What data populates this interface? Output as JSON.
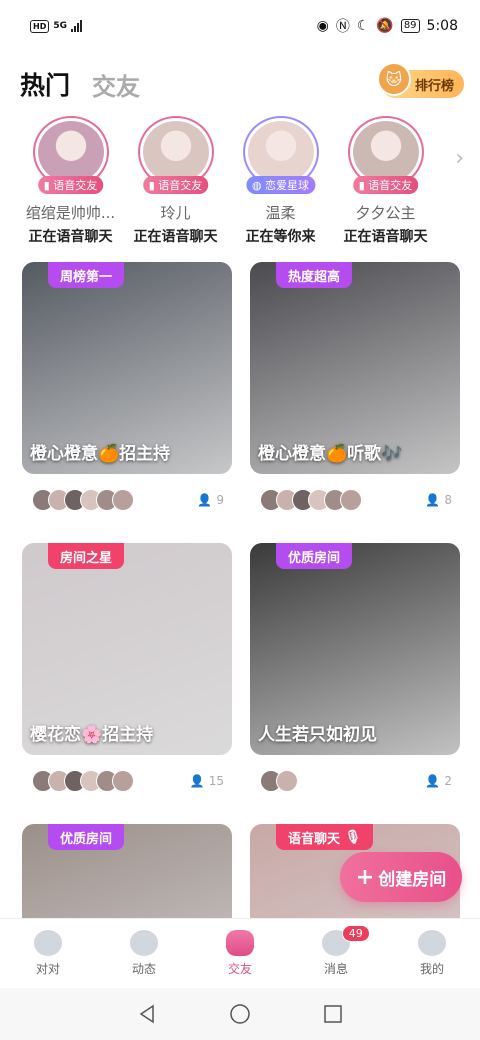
{
  "status_bar": {
    "net_label": "HD",
    "net_type": "5G",
    "battery": "89",
    "time": "5:08"
  },
  "header": {
    "tab_hot": "热门",
    "tab_friends": "交友",
    "rank_label": "排行榜"
  },
  "users": [
    {
      "name": "绾绾是帅帅...",
      "badge": "语音交友",
      "status": "正在语音聊天",
      "color": "#c9a0b5"
    },
    {
      "name": "玲儿",
      "badge": "语音交友",
      "status": "正在语音聊天",
      "color": "#d9c6c0"
    },
    {
      "name": "温柔",
      "badge": "恋爱星球",
      "status": "正在等你来",
      "color": "#e8d4cf"
    },
    {
      "name": "夕夕公主",
      "badge": "语音交友",
      "status": "正在语音聊天",
      "color": "#cdb9b3"
    }
  ],
  "rooms": [
    {
      "tag": "周榜第一",
      "tag_color": "#b44cf0",
      "title": "橙心橙意🍊招主持",
      "count": "9",
      "bg": "#555a62"
    },
    {
      "tag": "热度超高",
      "tag_color": "#b44cf0",
      "title": "橙心橙意🍊听歌🎶",
      "count": "8",
      "bg": "#4a4a4f"
    },
    {
      "tag": "房间之星",
      "tag_color": "#f0426a",
      "title": "樱花恋🌸招主持",
      "count": "15",
      "bg": "#cfc9cc"
    },
    {
      "tag": "优质房间",
      "tag_color": "#b44cf0",
      "title": "人生若只如初见",
      "count": "2",
      "bg": "#3a3a3a"
    },
    {
      "tag": "优质房间",
      "tag_color": "#b44cf0",
      "title": "",
      "count": "",
      "bg": "#9c8f8a"
    },
    {
      "tag": "语音聊天",
      "tag_color": "#f0426a",
      "title": "",
      "count": "",
      "bg": "#c8a8a6"
    }
  ],
  "create_room_label": "创建房间",
  "nav": {
    "items": [
      {
        "label": "对对",
        "icon": "heart-icon"
      },
      {
        "label": "动态",
        "icon": "planet-icon"
      },
      {
        "label": "交友",
        "icon": "smile-icon"
      },
      {
        "label": "消息",
        "icon": "chat-icon"
      },
      {
        "label": "我的",
        "icon": "profile-icon"
      }
    ],
    "message_badge": "49"
  },
  "colors": {
    "accent": "#e8508a",
    "tag_purple": "#b44cf0",
    "tag_red": "#f0426a"
  }
}
